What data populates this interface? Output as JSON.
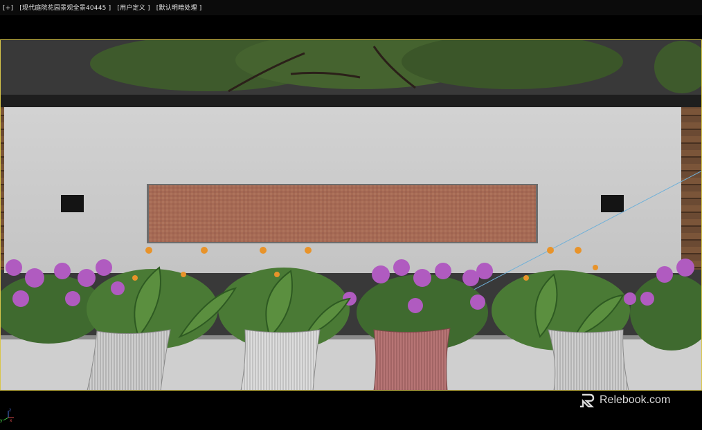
{
  "viewport_header": {
    "plus": "[+]",
    "scene_name": "[现代庭院花园景观全景40445 ]",
    "view_mode": "[用户定义 ]",
    "shading_mode": "[默认明暗处理 ]"
  },
  "scene": {
    "wall_color": "#cdcdcd",
    "panel_color": "#a86b55",
    "sky_color": "#3a3a3a",
    "foliage_color": "#3d5a2a",
    "flower_purple": "#b05bc0",
    "flower_orange": "#e8932a",
    "pillow_colors": [
      "#cfcfcf",
      "#d8d8d8",
      "#b77575",
      "#c9c9c9"
    ],
    "gizmo_line_color": "#6fb0d8",
    "border_color": "#d8c64a"
  },
  "axis": {
    "z": "z",
    "x": "x",
    "y": "y"
  },
  "watermark": {
    "brand": "RELEBOOK",
    "text": "Relebook.com",
    "icon": "relebook-logo-icon"
  }
}
